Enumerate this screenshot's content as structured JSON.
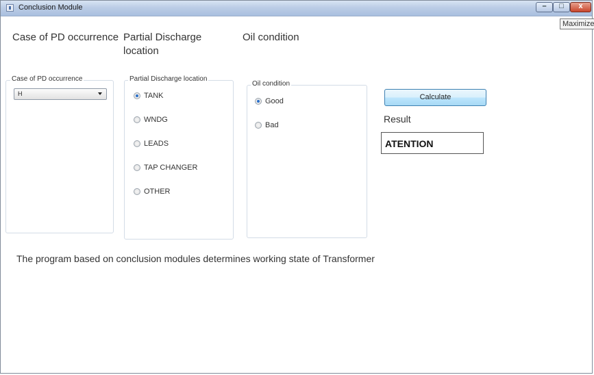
{
  "window": {
    "title": "Conclusion Module",
    "tooltip": "Maximize",
    "controls": {
      "minimize": "–",
      "maximize": "□",
      "close": "x"
    }
  },
  "columns": {
    "case_title": "Case of PD occurrence",
    "location_title": "Partial Discharge location",
    "oil_title": "Oil condition"
  },
  "case_group": {
    "label": "Case of PD occurrence",
    "combo_value": "H"
  },
  "location_group": {
    "label": "Partial Discharge location",
    "options": [
      {
        "label": "TANK",
        "checked": true
      },
      {
        "label": "WNDG",
        "checked": false
      },
      {
        "label": "LEADS",
        "checked": false
      },
      {
        "label": "TAP CHANGER",
        "checked": false
      },
      {
        "label": "OTHER",
        "checked": false
      }
    ]
  },
  "oil_group": {
    "label": "Oil condition",
    "options": [
      {
        "label": "Good",
        "checked": true
      },
      {
        "label": "Bad",
        "checked": false
      }
    ]
  },
  "actions": {
    "calculate_label": "Calculate"
  },
  "result": {
    "label": "Result",
    "value": "ATENTION"
  },
  "description": "The program based on conclusion modules determines working state of Transformer",
  "colors": {
    "button_border": "#3c7fb1",
    "radio_selected": "#2a6fc9",
    "titlebar": "#bccde6"
  }
}
